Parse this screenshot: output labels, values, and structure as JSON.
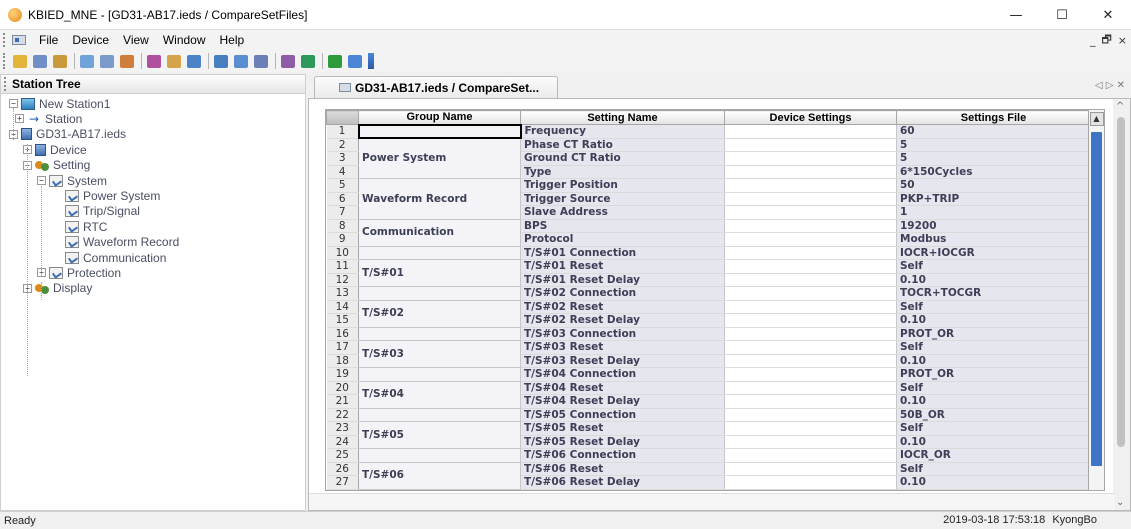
{
  "window": {
    "title": "KBIED_MNE - [GD31-AB17.ieds / CompareSetFiles]",
    "controls": [
      "—",
      "☐",
      "✕"
    ]
  },
  "menu": {
    "items": [
      "File",
      "Device",
      "View",
      "Window",
      "Help"
    ],
    "mdi_controls": [
      "_",
      "🗗",
      "×"
    ]
  },
  "toolbar": {
    "buttons": [
      {
        "icon": "open-folder-icon",
        "color": "#e2b53a"
      },
      {
        "icon": "save-icon",
        "color": "#6f8fc6"
      },
      {
        "icon": "device-add-icon",
        "color": "#c89a3b"
      },
      {
        "icon": "tree-icon",
        "color": "#6fa3d9"
      },
      {
        "icon": "properties-icon",
        "color": "#7a9acc"
      },
      {
        "icon": "refresh-icon",
        "color": "#d07c3a"
      },
      {
        "icon": "compare-icon",
        "color": "#b04f9e"
      },
      {
        "icon": "upload-icon",
        "color": "#d4a34a"
      },
      {
        "icon": "monitor-icon",
        "color": "#4e82c8"
      },
      {
        "icon": "grid-icon",
        "color": "#4a7fbf"
      },
      {
        "icon": "window-icon",
        "color": "#5a8ed0"
      },
      {
        "icon": "waveform-icon",
        "color": "#6c7fb6"
      },
      {
        "icon": "wave-compare-icon",
        "color": "#8f5da8"
      },
      {
        "icon": "export-icon",
        "color": "#2d9a5b"
      },
      {
        "icon": "cancel-icon",
        "color": "#2e9b3a"
      },
      {
        "icon": "help-icon",
        "color": "#4d86d6"
      }
    ]
  },
  "tree": {
    "header": "Station Tree",
    "nodes": [
      {
        "label": "New Station1",
        "icon": "station-icon",
        "expander": "−"
      },
      {
        "label": "Station",
        "icon": "arrow-icon",
        "expander": "+"
      },
      {
        "label": "GD31-AB17.ieds",
        "icon": "device-icon",
        "expander": "−"
      },
      {
        "label": "Device",
        "icon": "device-icon",
        "expander": "+"
      },
      {
        "label": "Setting",
        "icon": "setting-icon",
        "expander": "−"
      },
      {
        "label": "System",
        "icon": "page-icon",
        "expander": "−"
      },
      {
        "label": "Power System",
        "icon": "page-icon",
        "expander": ""
      },
      {
        "label": "Trip/Signal",
        "icon": "page-icon",
        "expander": ""
      },
      {
        "label": "RTC",
        "icon": "page-icon",
        "expander": ""
      },
      {
        "label": "Waveform Record",
        "icon": "page-icon",
        "expander": ""
      },
      {
        "label": "Communication",
        "icon": "page-icon",
        "expander": ""
      },
      {
        "label": "Protection",
        "icon": "page-icon",
        "expander": "+"
      },
      {
        "label": "Display",
        "icon": "setting-icon",
        "expander": "+"
      }
    ]
  },
  "document": {
    "tab_label": "GD31-AB17.ieds / CompareSet...",
    "tab_nav": "◁ ▷ ✕"
  },
  "grid": {
    "columns": [
      "Group Name",
      "Setting Name",
      "Device Settings",
      "Settings File"
    ],
    "rows": [
      [
        "1",
        "Frequency",
        "",
        "60"
      ],
      [
        "2",
        "Phase CT Ratio",
        "",
        "5"
      ],
      [
        "3",
        "Ground CT Ratio",
        "",
        "5"
      ],
      [
        "4",
        "Type",
        "",
        "6*150Cycles"
      ],
      [
        "5",
        "Trigger Position",
        "",
        "50"
      ],
      [
        "6",
        "Trigger Source",
        "",
        "PKP+TRIP"
      ],
      [
        "7",
        "Slave Address",
        "",
        "1"
      ],
      [
        "8",
        "BPS",
        "",
        "19200"
      ],
      [
        "9",
        "Protocol",
        "",
        "Modbus"
      ],
      [
        "10",
        "T/S#01 Connection",
        "",
        "IOCR+IOCGR"
      ],
      [
        "11",
        "T/S#01 Reset",
        "",
        "Self"
      ],
      [
        "12",
        "T/S#01 Reset Delay",
        "",
        "0.10"
      ],
      [
        "13",
        "T/S#02 Connection",
        "",
        "TOCR+TOCGR"
      ],
      [
        "14",
        "T/S#02 Reset",
        "",
        "Self"
      ],
      [
        "15",
        "T/S#02 Reset Delay",
        "",
        "0.10"
      ],
      [
        "16",
        "T/S#03 Connection",
        "",
        "PROT_OR"
      ],
      [
        "17",
        "T/S#03 Reset",
        "",
        "Self"
      ],
      [
        "18",
        "T/S#03 Reset Delay",
        "",
        "0.10"
      ],
      [
        "19",
        "T/S#04 Connection",
        "",
        "PROT_OR"
      ],
      [
        "20",
        "T/S#04 Reset",
        "",
        "Self"
      ],
      [
        "21",
        "T/S#04 Reset Delay",
        "",
        "0.10"
      ],
      [
        "22",
        "T/S#05 Connection",
        "",
        "50B_OR"
      ],
      [
        "23",
        "T/S#05 Reset",
        "",
        "Self"
      ],
      [
        "24",
        "T/S#05 Reset Delay",
        "",
        "0.10"
      ],
      [
        "25",
        "T/S#06 Connection",
        "",
        "IOCR_OR"
      ],
      [
        "26",
        "T/S#06 Reset",
        "",
        "Self"
      ],
      [
        "27",
        "T/S#06 Reset Delay",
        "",
        "0.10"
      ]
    ],
    "groups": [
      {
        "name": "",
        "rows": 1
      },
      {
        "name": "Power System",
        "rows": 3
      },
      {
        "name": "Waveform Record",
        "rows": 3
      },
      {
        "name": "Communication",
        "rows": 2
      },
      {
        "name": "",
        "rows": 1
      },
      {
        "name": "T/S#01",
        "rows": 2
      },
      {
        "name": "",
        "rows": 1
      },
      {
        "name": "T/S#02",
        "rows": 2
      },
      {
        "name": "",
        "rows": 1
      },
      {
        "name": "T/S#03",
        "rows": 2
      },
      {
        "name": "",
        "rows": 1
      },
      {
        "name": "T/S#04",
        "rows": 2
      },
      {
        "name": "",
        "rows": 1
      },
      {
        "name": "T/S#05",
        "rows": 2
      },
      {
        "name": "",
        "rows": 1
      },
      {
        "name": "T/S#06",
        "rows": 2
      }
    ]
  },
  "status": {
    "left": "Ready",
    "datetime": "2019-03-18 17:53:18",
    "user": "KyongBo"
  }
}
